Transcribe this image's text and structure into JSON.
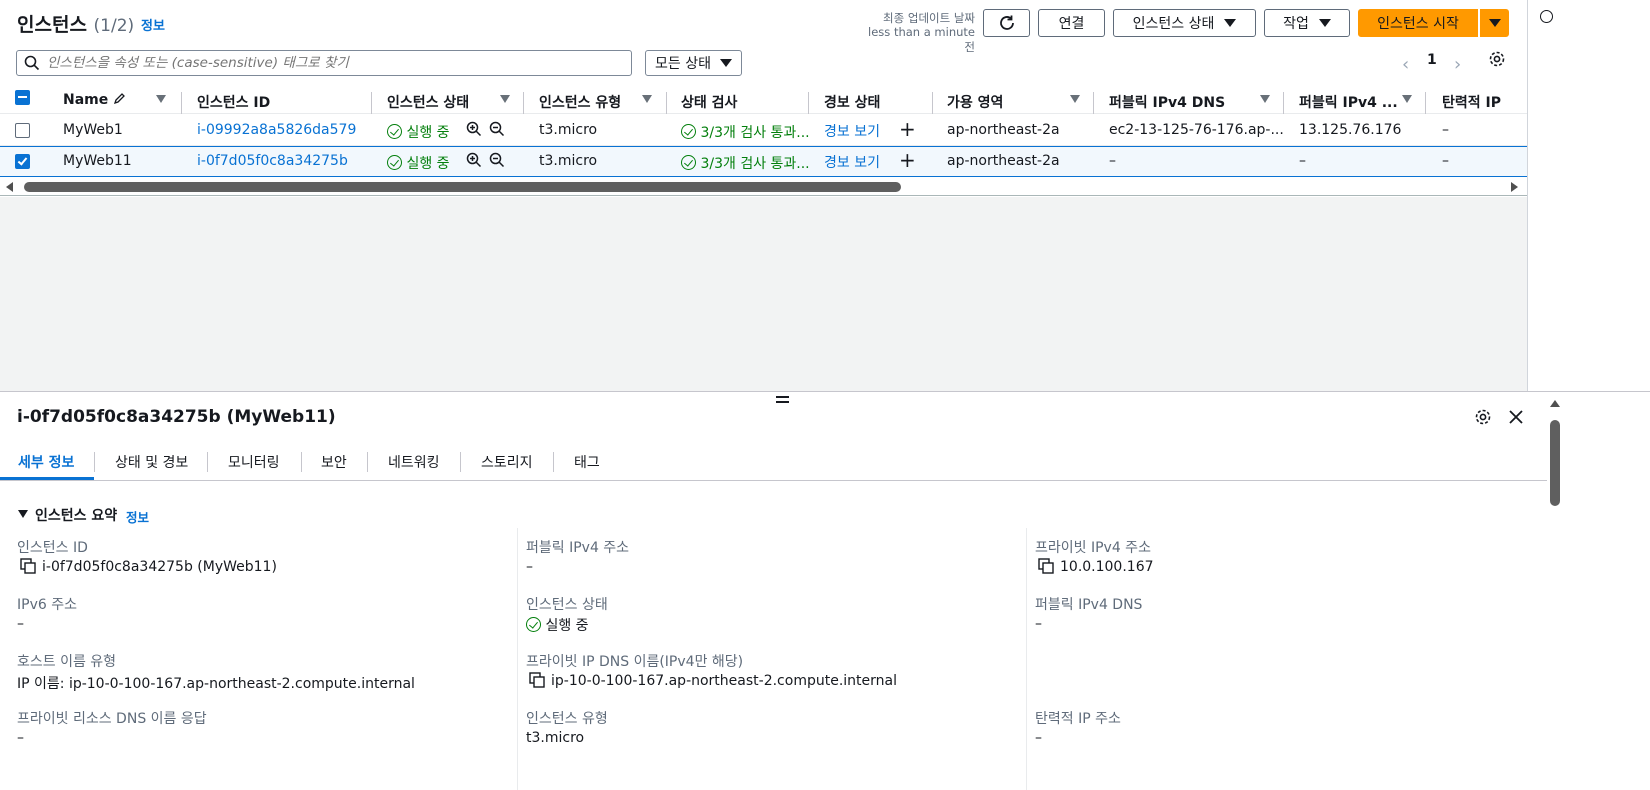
{
  "header": {
    "title": "인스턴스",
    "count": "(1/2)",
    "info": "정보",
    "last_updated_label": "최종 업데이트 날짜",
    "last_updated_value": "less than a minute 전",
    "connect": "연결",
    "instance_state": "인스턴스 상태",
    "actions": "작업",
    "launch": "인스턴스 시작"
  },
  "filter": {
    "placeholder": "인스턴스을 속성 또는 (case-sensitive) 태그로 찾기",
    "state_select": "모든 상태",
    "page": "1"
  },
  "table": {
    "columns": [
      "Name",
      "인스턴스 ID",
      "인스턴스 상태",
      "인스턴스 유형",
      "상태 검사",
      "경보 상태",
      "가용 영역",
      "퍼블릭 IPv4 DNS",
      "퍼블릭 IPv4 ...",
      "탄력적 IP"
    ],
    "rows": [
      {
        "name": "MyWeb1",
        "id": "i-09992a8a5826da579",
        "state": "실행 중",
        "type": "t3.micro",
        "check": "3/3개 검사 통과...",
        "alarm": "경보 보기",
        "az": "ap-northeast-2a",
        "dns": "ec2-13-125-76-176.ap-...",
        "ip": "13.125.76.176",
        "eip": "–"
      },
      {
        "name": "MyWeb11",
        "id": "i-0f7d05f0c8a34275b",
        "state": "실행 중",
        "type": "t3.micro",
        "check": "3/3개 검사 통과...",
        "alarm": "경보 보기",
        "az": "ap-northeast-2a",
        "dns": "–",
        "ip": "–",
        "eip": "–"
      }
    ]
  },
  "detail": {
    "title": "i-0f7d05f0c8a34275b (MyWeb11)",
    "tabs": [
      "세부 정보",
      "상태 및 경보",
      "모니터링",
      "보안",
      "네트워킹",
      "스토리지",
      "태그"
    ],
    "section": "인스턴스 요약",
    "section_info": "정보",
    "fields": {
      "instance_id_label": "인스턴스 ID",
      "instance_id_value": "i-0f7d05f0c8a34275b (MyWeb11)",
      "public_ipv4_label": "퍼블릭 IPv4 주소",
      "public_ipv4_value": "–",
      "private_ipv4_label": "프라이빗 IPv4 주소",
      "private_ipv4_value": "10.0.100.167",
      "ipv6_label": "IPv6 주소",
      "ipv6_value": "–",
      "state_label": "인스턴스 상태",
      "state_value": "실행 중",
      "public_dns_label": "퍼블릭 IPv4 DNS",
      "public_dns_value": "–",
      "hostname_type_label": "호스트 이름 유형",
      "hostname_type_value": "IP 이름: ip-10-0-100-167.ap-northeast-2.compute.internal",
      "private_dns_label": "프라이빗 IP DNS 이름(IPv4만 해당)",
      "private_dns_value": "ip-10-0-100-167.ap-northeast-2.compute.internal",
      "resource_dns_label": "프라이빗 리소스 DNS 이름 응답",
      "resource_dns_value": "–",
      "instance_type_label": "인스턴스 유형",
      "instance_type_value": "t3.micro",
      "elastic_ip_label": "탄력적 IP 주소",
      "elastic_ip_value": "–"
    }
  },
  "colors": {
    "accent": "#ff9900",
    "link": "#0972d3",
    "success": "#037f0c"
  }
}
